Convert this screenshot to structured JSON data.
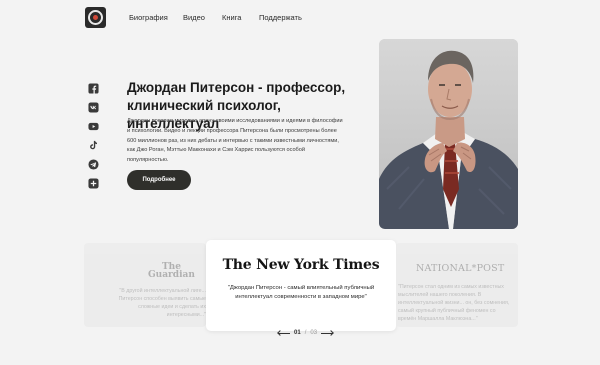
{
  "nav": {
    "logo_icon": "site-logo-icon",
    "items": [
      {
        "label": "Биография"
      },
      {
        "label": "Видео"
      },
      {
        "label": "Книга"
      },
      {
        "label": "Поддержать"
      }
    ]
  },
  "social": [
    {
      "icon": "facebook-icon"
    },
    {
      "icon": "vk-icon"
    },
    {
      "icon": "youtube-icon"
    },
    {
      "icon": "tiktok-icon"
    },
    {
      "icon": "telegram-icon"
    },
    {
      "icon": "more-icon"
    }
  ],
  "hero": {
    "title": "Джордан Питерсон - профессор, клинический психолог, интеллектуал",
    "text": "Джордан покорил мировую арену своими исследованиями и идеями в философии и психологии. Видео и лекции профессора Питерсона были просмотрены более 600 миллионов раз, из них дебаты и интервью с такими известными личностями, как Джо Роган, Мэттью Макконахи и Сэм Харрис пользуются особой популярностью.",
    "button_label": "Подробнее"
  },
  "quotes": {
    "left": {
      "source": "The Guardian",
      "logo_line1": "The",
      "logo_line2": "Guardian",
      "text": "\"В другой интеллектуальной лиге... Питерсон способен выявить самые сложные идеи и сделать их интересными...\""
    },
    "center": {
      "source": "The New York Times",
      "text": "\"Джордан Питерсон - самый влиятельный публичный интеллектуал современности в западном мире\""
    },
    "right": {
      "source": "NATIONAL*POST",
      "text": "\"Питерсон стал одним из самых известных мыслителей нашего поколения. В интеллектуальной жизни... он, без сомнения, самый крупный публичный феномен со времён Маршалла Маклюэна...\""
    }
  },
  "pager": {
    "current": "01",
    "separator": "/",
    "total": "03"
  }
}
